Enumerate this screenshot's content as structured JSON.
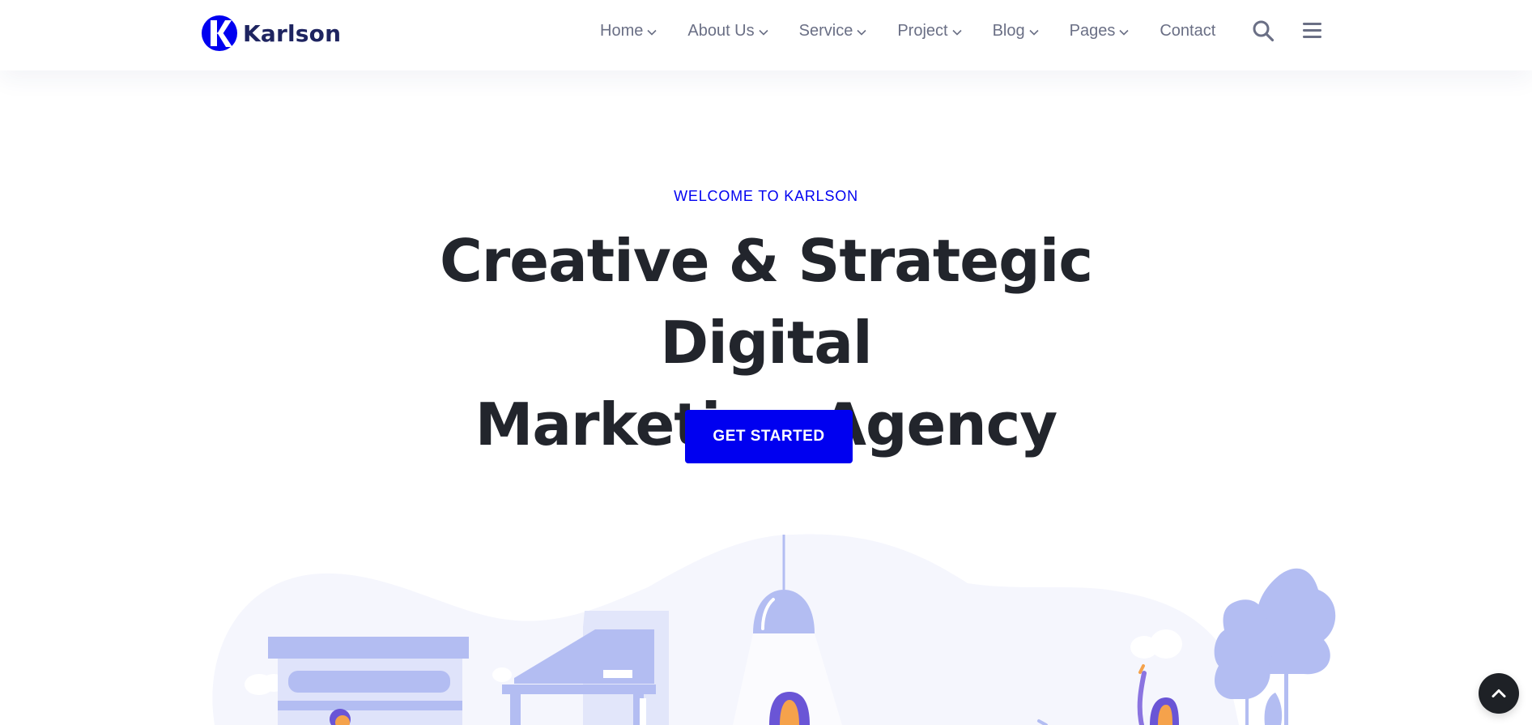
{
  "brand": {
    "name": "Karlson",
    "logo_color": "#0000f0",
    "text_color": "#1e2460"
  },
  "nav": {
    "items": [
      {
        "label": "Home",
        "has_dropdown": true
      },
      {
        "label": "About Us",
        "has_dropdown": true
      },
      {
        "label": "Service",
        "has_dropdown": true
      },
      {
        "label": "Project",
        "has_dropdown": true
      },
      {
        "label": "Blog",
        "has_dropdown": true
      },
      {
        "label": "Pages",
        "has_dropdown": true
      },
      {
        "label": "Contact",
        "has_dropdown": false
      }
    ],
    "search_icon": "search-icon",
    "menu_icon": "hamburger-menu-icon"
  },
  "hero": {
    "eyebrow": "WELCOME TO KARLSON",
    "title_line1": "Creative & Strategic Digital",
    "title_line2": "Marketing Agency",
    "cta_label": "GET STARTED"
  },
  "colors": {
    "accent": "#0000f0",
    "heading": "#22252c",
    "nav_text": "#6a6f85",
    "illustration_light": "#f5f6fd",
    "illustration_mid": "#b3bdf2",
    "back_to_top_bg": "#1e2126"
  },
  "back_to_top": {
    "icon": "chevron-up-icon"
  }
}
